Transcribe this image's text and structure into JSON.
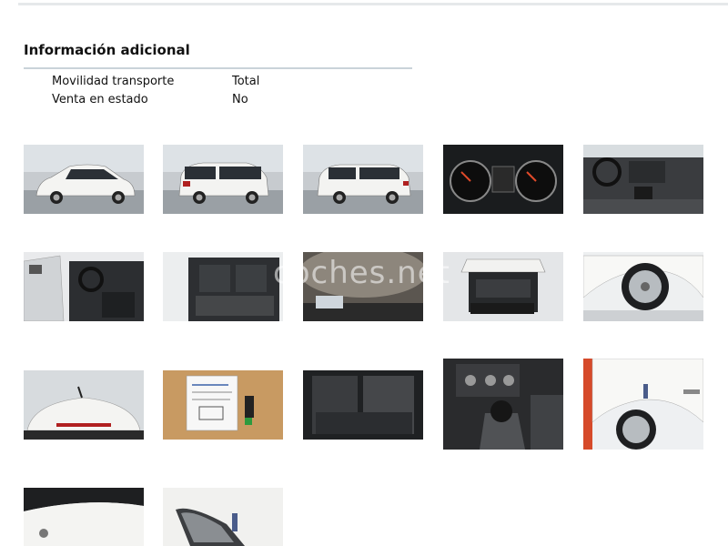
{
  "section": {
    "title": "Información adicional",
    "rows": [
      {
        "label": "Movilidad transporte",
        "value": "Total"
      },
      {
        "label": "Venta en estado",
        "value": "No"
      }
    ]
  },
  "gallery": {
    "watermark": "coches.net",
    "photos": [
      {
        "subject": "car-front-three-quarter"
      },
      {
        "subject": "car-rear-three-quarter"
      },
      {
        "subject": "car-rear-three-quarter-2"
      },
      {
        "subject": "instrument-cluster"
      },
      {
        "subject": "dashboard-interior"
      },
      {
        "subject": "driver-door-open"
      },
      {
        "subject": "rear-seats"
      },
      {
        "subject": "headliner-roof"
      },
      {
        "subject": "open-trunk"
      },
      {
        "subject": "wheel-detail"
      },
      {
        "subject": "roof-antenna"
      },
      {
        "subject": "keys-and-documents"
      },
      {
        "subject": "rear-seat-detail"
      },
      {
        "subject": "gear-shifter"
      },
      {
        "subject": "rear-wheel-side"
      },
      {
        "subject": "hood-detail"
      },
      {
        "subject": "headlight-detail"
      }
    ]
  }
}
